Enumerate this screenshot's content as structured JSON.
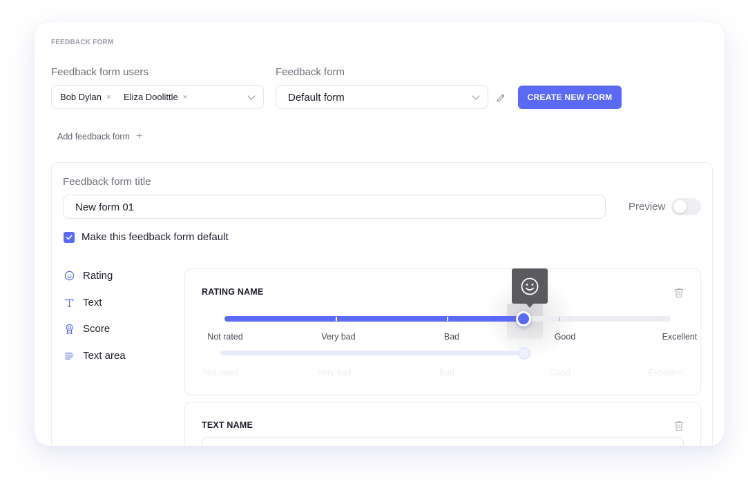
{
  "header": {
    "section_label": "FEEDBACK FORM"
  },
  "users": {
    "label": "Feedback form users",
    "selected": [
      {
        "name": "Bob Dylan"
      },
      {
        "name": "Eliza Doolittle"
      }
    ],
    "remove_glyph": "×"
  },
  "form_select": {
    "label": "Feedback form",
    "value": "Default form"
  },
  "create_button": {
    "label": "CREATE NEW FORM"
  },
  "add_form": {
    "label": "Add feedback form",
    "glyph": "+"
  },
  "editor": {
    "title_label": "Feedback form title",
    "title_value": "New form 01",
    "preview_label": "Preview",
    "preview_on": false,
    "default_checkbox": {
      "label": "Make this feedback form default",
      "checked": true
    }
  },
  "toolbox": {
    "items": [
      {
        "label": "Rating",
        "icon": "smiley-icon"
      },
      {
        "label": "Text",
        "icon": "text-t-icon"
      },
      {
        "label": "Score",
        "icon": "award-icon"
      },
      {
        "label": "Text area",
        "icon": "text-lines-icon"
      }
    ]
  },
  "rating_block": {
    "title": "RATING NAME",
    "scale": [
      "Not rated",
      "Very bad",
      "Bad",
      "Good",
      "Excellent"
    ],
    "value": 2.68,
    "tooltip_icon": "smiley-icon",
    "ghost_scale": [
      "Not rated",
      "Very bad",
      "Bad",
      "Good",
      "Excellent"
    ]
  },
  "text_block": {
    "title": "TEXT NAME"
  },
  "colors": {
    "accent": "#5b6af5",
    "tooltip": "#5b5b5f",
    "track": "#ededf1"
  }
}
